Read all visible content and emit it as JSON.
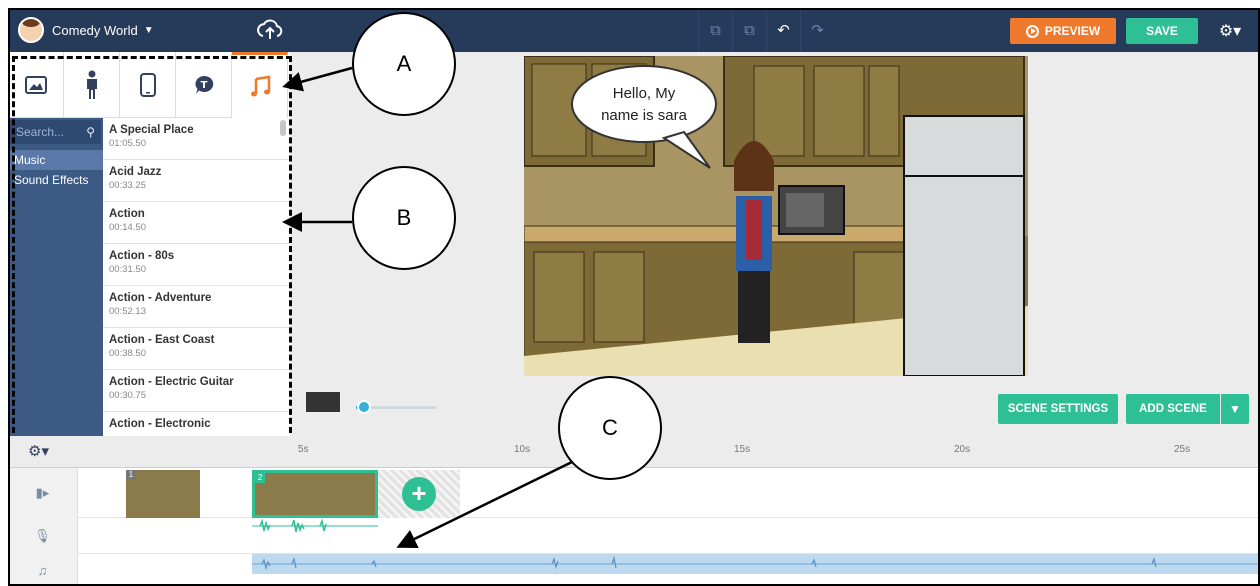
{
  "project": {
    "name": "Comedy World"
  },
  "toolbar": {
    "preview_label": "PREVIEW",
    "save_label": "SAVE"
  },
  "panel": {
    "tabs": [
      "image",
      "character",
      "prop",
      "speech",
      "music"
    ],
    "active_tab": "music",
    "search_placeholder": "Search...",
    "categories": [
      {
        "label": "Music",
        "active": true
      },
      {
        "label": "Sound Effects",
        "active": false
      }
    ],
    "tracks": [
      {
        "title": "A Special Place",
        "duration": "01:05.50"
      },
      {
        "title": "Acid Jazz",
        "duration": "00:33.25"
      },
      {
        "title": "Action",
        "duration": "00:14.50"
      },
      {
        "title": "Action - 80s",
        "duration": "00:31.50"
      },
      {
        "title": "Action - Adventure",
        "duration": "00:52.13"
      },
      {
        "title": "Action - East Coast",
        "duration": "00:38.50"
      },
      {
        "title": "Action - Electric Guitar",
        "duration": "00:30.75"
      },
      {
        "title": "Action - Electronic",
        "duration": ""
      }
    ]
  },
  "scene": {
    "speech_line1": "Hello, My",
    "speech_line2": "name is sara"
  },
  "zoom_level": 0.1,
  "buttons": {
    "scene_settings": "SCENE SETTINGS",
    "add_scene": "ADD SCENE"
  },
  "timeline": {
    "ruler": [
      "5s",
      "10s",
      "15s",
      "20s",
      "25s"
    ],
    "scenes": [
      "1",
      "2"
    ]
  },
  "callouts": {
    "a": "A",
    "b": "B",
    "c": "C"
  },
  "colors": {
    "topbar": "#263a5a",
    "accent_orange": "#ef7a2e",
    "accent_green": "#2fbf95",
    "sidebar": "#3d5a85"
  }
}
